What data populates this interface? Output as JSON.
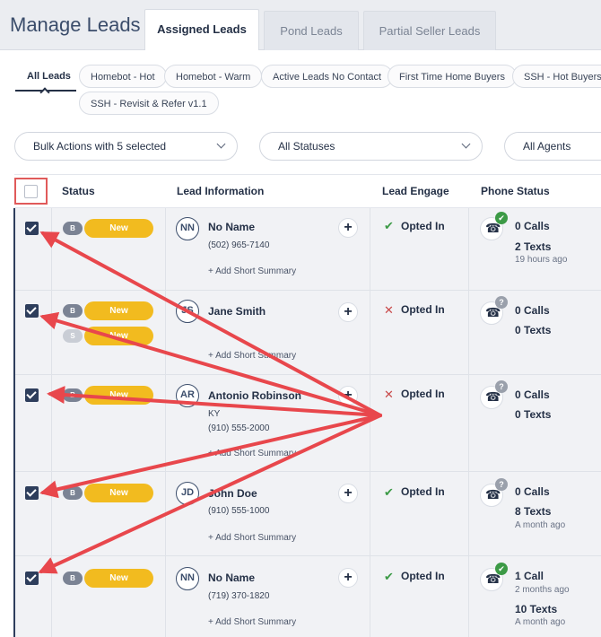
{
  "header": {
    "title": "Manage Leads",
    "tabs": [
      {
        "label": "Assigned Leads",
        "active": true
      },
      {
        "label": "Pond Leads",
        "active": false
      },
      {
        "label": "Partial Seller Leads",
        "active": false
      }
    ]
  },
  "filters": {
    "chips": [
      "All Leads",
      "Homebot - Hot",
      "Homebot - Warm",
      "Active Leads No Contact",
      "First Time Home Buyers",
      "SSH - Hot Buyers N",
      "SSH - Revisit & Refer v1.1"
    ],
    "bulk_actions": "Bulk Actions with 5 selected",
    "statuses": "All Statuses",
    "agents": "All Agents"
  },
  "table": {
    "columns": [
      "Status",
      "Lead Information",
      "Lead Engage",
      "Phone Status"
    ],
    "summary_label": "+ Add Short Summary",
    "rows": [
      {
        "badge": "B",
        "badge2": "",
        "status": "New",
        "status2": "",
        "initials": "NN",
        "name": "No Name",
        "line1": "(502) 965-7140",
        "line2": "",
        "engage_icon": "✔",
        "engage": "Opted In",
        "phone_badge": "✔",
        "calls": "0 Calls",
        "calls_time": "",
        "texts": "2 Texts",
        "texts_time": "19 hours ago"
      },
      {
        "badge": "B",
        "badge2": "S",
        "status": "New",
        "status2": "New",
        "initials": "JS",
        "name": "Jane Smith",
        "line1": "",
        "line2": "",
        "engage_icon": "✕",
        "engage": "Opted In",
        "phone_badge": "?",
        "calls": "0 Calls",
        "calls_time": "",
        "texts": "0 Texts",
        "texts_time": ""
      },
      {
        "badge": "B",
        "badge2": "",
        "status": "New",
        "status2": "",
        "initials": "AR",
        "name": "Antonio Robinson",
        "line1": "KY",
        "line2": "(910) 555-2000",
        "engage_icon": "✕",
        "engage": "Opted In",
        "phone_badge": "?",
        "calls": "0 Calls",
        "calls_time": "",
        "texts": "0 Texts",
        "texts_time": ""
      },
      {
        "badge": "B",
        "badge2": "",
        "status": "New",
        "status2": "",
        "initials": "JD",
        "name": "John Doe",
        "line1": "(910) 555-1000",
        "line2": "",
        "engage_icon": "✔",
        "engage": "Opted In",
        "phone_badge": "?",
        "calls": "0 Calls",
        "calls_time": "",
        "texts": "8 Texts",
        "texts_time": "A month ago"
      },
      {
        "badge": "B",
        "badge2": "",
        "status": "New",
        "status2": "",
        "initials": "NN",
        "name": "No Name",
        "line1": "(719) 370-1820",
        "line2": "",
        "engage_icon": "✔",
        "engage": "Opted In",
        "phone_badge": "✔",
        "calls": "1 Call",
        "calls_time": "2 months ago",
        "texts": "10 Texts",
        "texts_time": "A month ago"
      }
    ]
  },
  "icons": {
    "phone": "☎",
    "plus": "+",
    "colors": {
      "accent": "#2e3e5c",
      "status_new": "#f2bb1f",
      "opted_ok": "#3c9a46",
      "opted_no": "#c94a4a",
      "annotation": "#e8474c"
    }
  }
}
